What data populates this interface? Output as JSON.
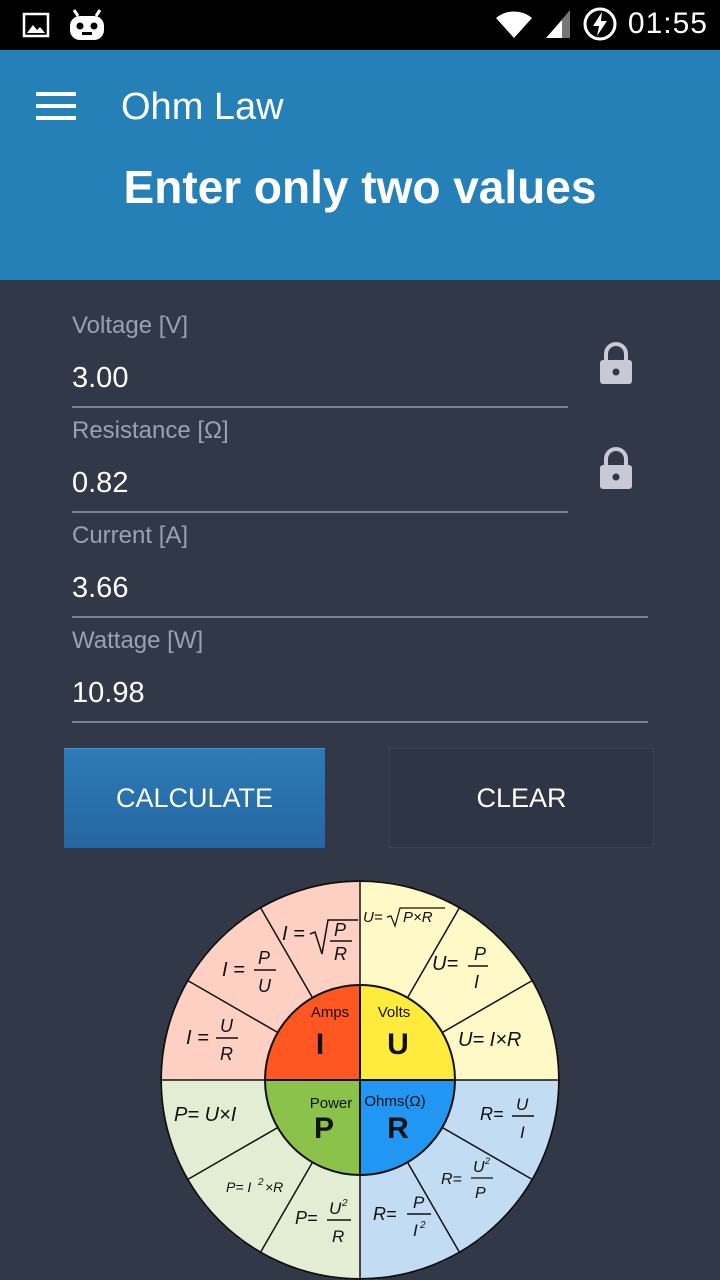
{
  "status_bar": {
    "time": "01:55"
  },
  "app_bar": {
    "title": "Ohm Law",
    "subtitle": "Enter only two values"
  },
  "fields": {
    "voltage": {
      "label": "Voltage [V]",
      "value": "3.00",
      "locked": true
    },
    "resistance": {
      "label": "Resistance [Ω]",
      "value": "0.82",
      "locked": true
    },
    "current": {
      "label": "Current [A]",
      "value": "3.66"
    },
    "wattage": {
      "label": "Wattage [W]",
      "value": "10.98"
    }
  },
  "buttons": {
    "calculate": "CALCULATE",
    "clear": "CLEAR"
  },
  "wheel": {
    "center": {
      "amps_label": "Amps",
      "amps_symbol": "I",
      "volts_label": "Volts",
      "volts_symbol": "U",
      "power_label": "Power",
      "power_symbol": "P",
      "ohms_label": "Ohms(Ω)",
      "ohms_symbol": "R"
    },
    "colors": {
      "amps": "#ff5722",
      "volts": "#ffeb3b",
      "power": "#8bc34a",
      "ohms": "#2196f3",
      "amps_outer": "#fdd0c3",
      "volts_outer": "#fff9c7",
      "power_outer": "#e2edd3",
      "ohms_outer": "#c2dcf3"
    }
  }
}
